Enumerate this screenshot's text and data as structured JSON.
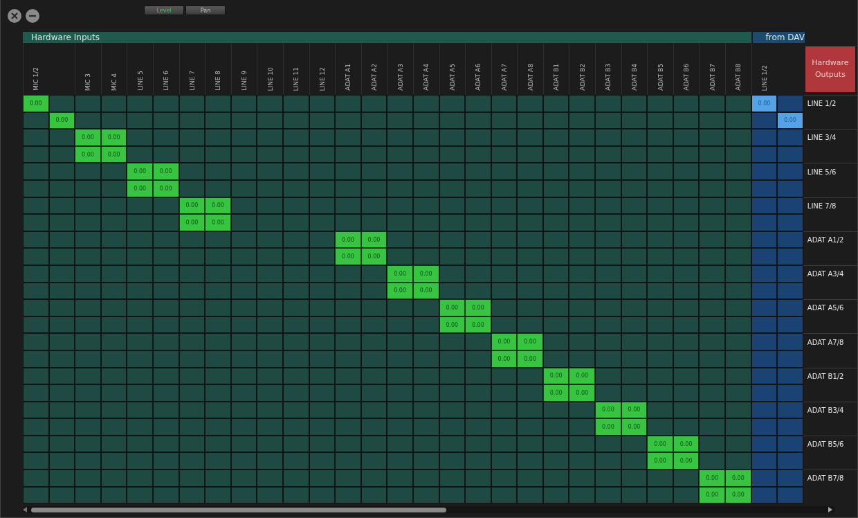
{
  "tabs": [
    {
      "label": "Level",
      "selected": true
    },
    {
      "label": "Pan",
      "selected": false
    }
  ],
  "sections": [
    {
      "label": "Hardware Inputs",
      "kind": "hardware"
    },
    {
      "label": "from DAV",
      "kind": "daw"
    }
  ],
  "columns": [
    {
      "label": "MIC 1/2",
      "kind": "hardware"
    },
    {
      "kind": "hardware"
    },
    {
      "label": "MIC 3",
      "kind": "hardware"
    },
    {
      "label": "MIC 4",
      "kind": "hardware"
    },
    {
      "label": "LINE 5",
      "kind": "hardware"
    },
    {
      "label": "LINE 6",
      "kind": "hardware"
    },
    {
      "label": "LINE 7",
      "kind": "hardware"
    },
    {
      "label": "LINE 8",
      "kind": "hardware"
    },
    {
      "label": "LINE 9",
      "kind": "hardware"
    },
    {
      "label": "LINE 10",
      "kind": "hardware"
    },
    {
      "label": "LINE 11",
      "kind": "hardware"
    },
    {
      "label": "LINE 12",
      "kind": "hardware"
    },
    {
      "label": "ADAT A1",
      "kind": "hardware"
    },
    {
      "label": "ADAT A2",
      "kind": "hardware"
    },
    {
      "label": "ADAT A3",
      "kind": "hardware"
    },
    {
      "label": "ADAT A4",
      "kind": "hardware"
    },
    {
      "label": "ADAT A5",
      "kind": "hardware"
    },
    {
      "label": "ADAT A6",
      "kind": "hardware"
    },
    {
      "label": "ADAT A7",
      "kind": "hardware"
    },
    {
      "label": "ADAT A8",
      "kind": "hardware"
    },
    {
      "label": "ADAT B1",
      "kind": "hardware"
    },
    {
      "label": "ADAT B2",
      "kind": "hardware"
    },
    {
      "label": "ADAT B3",
      "kind": "hardware"
    },
    {
      "label": "ADAT B4",
      "kind": "hardware"
    },
    {
      "label": "ADAT B5",
      "kind": "hardware"
    },
    {
      "label": "ADAT B6",
      "kind": "hardware"
    },
    {
      "label": "ADAT B7",
      "kind": "hardware"
    },
    {
      "label": "ADAT B8",
      "kind": "hardware"
    },
    {
      "label": "LINE 1/2",
      "kind": "daw"
    },
    {
      "kind": "daw"
    }
  ],
  "outputs_button": {
    "label": "Hardware Outputs"
  },
  "rows": [
    {
      "output": "LINE 1/2",
      "cells": [
        "0.00",
        null,
        null,
        null,
        null,
        null,
        null,
        null,
        null,
        null,
        null,
        null,
        null,
        null,
        null,
        null,
        null,
        null,
        null,
        null,
        null,
        null,
        null,
        null,
        null,
        null,
        null,
        null,
        "0.00",
        null
      ]
    },
    {
      "cells": [
        null,
        "0.00",
        null,
        null,
        null,
        null,
        null,
        null,
        null,
        null,
        null,
        null,
        null,
        null,
        null,
        null,
        null,
        null,
        null,
        null,
        null,
        null,
        null,
        null,
        null,
        null,
        null,
        null,
        null,
        "0.00"
      ]
    },
    {
      "output": "LINE 3/4",
      "cells": [
        null,
        null,
        "0.00",
        "0.00",
        null,
        null,
        null,
        null,
        null,
        null,
        null,
        null,
        null,
        null,
        null,
        null,
        null,
        null,
        null,
        null,
        null,
        null,
        null,
        null,
        null,
        null,
        null,
        null,
        null,
        null
      ]
    },
    {
      "cells": [
        null,
        null,
        "0.00",
        "0.00",
        null,
        null,
        null,
        null,
        null,
        null,
        null,
        null,
        null,
        null,
        null,
        null,
        null,
        null,
        null,
        null,
        null,
        null,
        null,
        null,
        null,
        null,
        null,
        null,
        null,
        null
      ]
    },
    {
      "output": "LINE 5/6",
      "cells": [
        null,
        null,
        null,
        null,
        "0.00",
        "0.00",
        null,
        null,
        null,
        null,
        null,
        null,
        null,
        null,
        null,
        null,
        null,
        null,
        null,
        null,
        null,
        null,
        null,
        null,
        null,
        null,
        null,
        null,
        null,
        null
      ]
    },
    {
      "cells": [
        null,
        null,
        null,
        null,
        "0.00",
        "0.00",
        null,
        null,
        null,
        null,
        null,
        null,
        null,
        null,
        null,
        null,
        null,
        null,
        null,
        null,
        null,
        null,
        null,
        null,
        null,
        null,
        null,
        null,
        null,
        null
      ]
    },
    {
      "output": "LINE 7/8",
      "cells": [
        null,
        null,
        null,
        null,
        null,
        null,
        "0.00",
        "0.00",
        null,
        null,
        null,
        null,
        null,
        null,
        null,
        null,
        null,
        null,
        null,
        null,
        null,
        null,
        null,
        null,
        null,
        null,
        null,
        null,
        null,
        null
      ]
    },
    {
      "cells": [
        null,
        null,
        null,
        null,
        null,
        null,
        "0.00",
        "0.00",
        null,
        null,
        null,
        null,
        null,
        null,
        null,
        null,
        null,
        null,
        null,
        null,
        null,
        null,
        null,
        null,
        null,
        null,
        null,
        null,
        null,
        null
      ]
    },
    {
      "output": "ADAT A1/2",
      "cells": [
        null,
        null,
        null,
        null,
        null,
        null,
        null,
        null,
        null,
        null,
        null,
        null,
        "0.00",
        "0.00",
        null,
        null,
        null,
        null,
        null,
        null,
        null,
        null,
        null,
        null,
        null,
        null,
        null,
        null,
        null,
        null
      ]
    },
    {
      "cells": [
        null,
        null,
        null,
        null,
        null,
        null,
        null,
        null,
        null,
        null,
        null,
        null,
        "0.00",
        "0.00",
        null,
        null,
        null,
        null,
        null,
        null,
        null,
        null,
        null,
        null,
        null,
        null,
        null,
        null,
        null,
        null
      ]
    },
    {
      "output": "ADAT A3/4",
      "cells": [
        null,
        null,
        null,
        null,
        null,
        null,
        null,
        null,
        null,
        null,
        null,
        null,
        null,
        null,
        "0.00",
        "0.00",
        null,
        null,
        null,
        null,
        null,
        null,
        null,
        null,
        null,
        null,
        null,
        null,
        null,
        null
      ]
    },
    {
      "cells": [
        null,
        null,
        null,
        null,
        null,
        null,
        null,
        null,
        null,
        null,
        null,
        null,
        null,
        null,
        "0.00",
        "0.00",
        null,
        null,
        null,
        null,
        null,
        null,
        null,
        null,
        null,
        null,
        null,
        null,
        null,
        null
      ]
    },
    {
      "output": "ADAT A5/6",
      "cells": [
        null,
        null,
        null,
        null,
        null,
        null,
        null,
        null,
        null,
        null,
        null,
        null,
        null,
        null,
        null,
        null,
        "0.00",
        "0.00",
        null,
        null,
        null,
        null,
        null,
        null,
        null,
        null,
        null,
        null,
        null,
        null
      ]
    },
    {
      "cells": [
        null,
        null,
        null,
        null,
        null,
        null,
        null,
        null,
        null,
        null,
        null,
        null,
        null,
        null,
        null,
        null,
        "0.00",
        "0.00",
        null,
        null,
        null,
        null,
        null,
        null,
        null,
        null,
        null,
        null,
        null,
        null
      ]
    },
    {
      "output": "ADAT A7/8",
      "cells": [
        null,
        null,
        null,
        null,
        null,
        null,
        null,
        null,
        null,
        null,
        null,
        null,
        null,
        null,
        null,
        null,
        null,
        null,
        "0.00",
        "0.00",
        null,
        null,
        null,
        null,
        null,
        null,
        null,
        null,
        null,
        null
      ]
    },
    {
      "cells": [
        null,
        null,
        null,
        null,
        null,
        null,
        null,
        null,
        null,
        null,
        null,
        null,
        null,
        null,
        null,
        null,
        null,
        null,
        "0.00",
        "0.00",
        null,
        null,
        null,
        null,
        null,
        null,
        null,
        null,
        null,
        null
      ]
    },
    {
      "output": "ADAT B1/2",
      "cells": [
        null,
        null,
        null,
        null,
        null,
        null,
        null,
        null,
        null,
        null,
        null,
        null,
        null,
        null,
        null,
        null,
        null,
        null,
        null,
        null,
        "0.00",
        "0.00",
        null,
        null,
        null,
        null,
        null,
        null,
        null,
        null
      ]
    },
    {
      "cells": [
        null,
        null,
        null,
        null,
        null,
        null,
        null,
        null,
        null,
        null,
        null,
        null,
        null,
        null,
        null,
        null,
        null,
        null,
        null,
        null,
        "0.00",
        "0.00",
        null,
        null,
        null,
        null,
        null,
        null,
        null,
        null
      ]
    },
    {
      "output": "ADAT B3/4",
      "cells": [
        null,
        null,
        null,
        null,
        null,
        null,
        null,
        null,
        null,
        null,
        null,
        null,
        null,
        null,
        null,
        null,
        null,
        null,
        null,
        null,
        null,
        null,
        "0.00",
        "0.00",
        null,
        null,
        null,
        null,
        null,
        null
      ]
    },
    {
      "cells": [
        null,
        null,
        null,
        null,
        null,
        null,
        null,
        null,
        null,
        null,
        null,
        null,
        null,
        null,
        null,
        null,
        null,
        null,
        null,
        null,
        null,
        null,
        "0.00",
        "0.00",
        null,
        null,
        null,
        null,
        null,
        null
      ]
    },
    {
      "output": "ADAT B5/6",
      "cells": [
        null,
        null,
        null,
        null,
        null,
        null,
        null,
        null,
        null,
        null,
        null,
        null,
        null,
        null,
        null,
        null,
        null,
        null,
        null,
        null,
        null,
        null,
        null,
        null,
        "0.00",
        "0.00",
        null,
        null,
        null,
        null
      ]
    },
    {
      "cells": [
        null,
        null,
        null,
        null,
        null,
        null,
        null,
        null,
        null,
        null,
        null,
        null,
        null,
        null,
        null,
        null,
        null,
        null,
        null,
        null,
        null,
        null,
        null,
        null,
        "0.00",
        "0.00",
        null,
        null,
        null,
        null
      ]
    },
    {
      "output": "ADAT B7/8",
      "cells": [
        null,
        null,
        null,
        null,
        null,
        null,
        null,
        null,
        null,
        null,
        null,
        null,
        null,
        null,
        null,
        null,
        null,
        null,
        null,
        null,
        null,
        null,
        null,
        null,
        null,
        null,
        "0.00",
        "0.00",
        null,
        null
      ]
    },
    {
      "cells": [
        null,
        null,
        null,
        null,
        null,
        null,
        null,
        null,
        null,
        null,
        null,
        null,
        null,
        null,
        null,
        null,
        null,
        null,
        null,
        null,
        null,
        null,
        null,
        null,
        null,
        null,
        "0.00",
        "0.00",
        null,
        null
      ]
    }
  ]
}
